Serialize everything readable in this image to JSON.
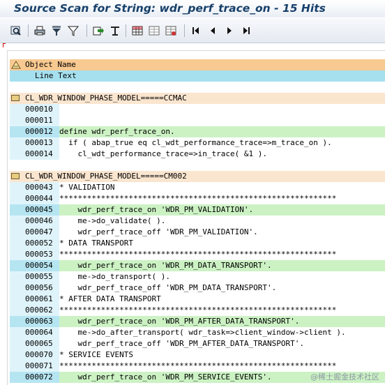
{
  "window": {
    "title": "Source Scan for String: wdr_perf_trace_on - 15 Hits"
  },
  "toolbar": {
    "icons": [
      "find-icon",
      "print-icon",
      "filter-icon",
      "funnel-icon",
      "export-icon",
      "sort-icon",
      "grid-icon",
      "layout-icon",
      "layout-change-icon",
      "first-page-icon",
      "prev-page-icon",
      "next-page-icon",
      "last-page-icon"
    ]
  },
  "list_header": {
    "col1": "Object Name",
    "col2": "Line Text"
  },
  "blocks": [
    {
      "object": "CL_WDR_WINDOW_PHASE_MODEL=====CCMAC",
      "lines": [
        {
          "num": "000010",
          "text": "",
          "hit": false
        },
        {
          "num": "000011",
          "text": "",
          "hit": false
        },
        {
          "num": "000012",
          "text": "define wdr_perf_trace_on.",
          "hit": true
        },
        {
          "num": "000013",
          "text": "  if ( abap_true eq cl_wdt_performance_trace=>m_trace_on ).",
          "hit": false
        },
        {
          "num": "000014",
          "text": "    cl_wdt_performance_trace=>in_trace( &1 ).",
          "hit": false
        }
      ]
    },
    {
      "object": "CL_WDR_WINDOW_PHASE_MODEL=====CM002",
      "lines": [
        {
          "num": "000043",
          "text": "* VALIDATION",
          "hit": false
        },
        {
          "num": "000044",
          "text": "************************************************************",
          "hit": false
        },
        {
          "num": "000045",
          "text": "    wdr_perf_trace_on 'WDR_PM_VALIDATION'.",
          "hit": true
        },
        {
          "num": "000046",
          "text": "    me->do_validate( ).",
          "hit": false
        },
        {
          "num": "000047",
          "text": "    wdr_perf_trace_off 'WDR_PM_VALIDATION'.",
          "hit": false
        },
        {
          "num": "000052",
          "text": "* DATA TRANSPORT",
          "hit": false
        },
        {
          "num": "000053",
          "text": "************************************************************",
          "hit": false
        },
        {
          "num": "000054",
          "text": "    wdr_perf_trace_on 'WDR_PM_DATA_TRANSPORT'.",
          "hit": true
        },
        {
          "num": "000055",
          "text": "    me->do_transport( ).",
          "hit": false
        },
        {
          "num": "000056",
          "text": "    wdr_perf_trace_off 'WDR_PM_DATA_TRANSPORT'.",
          "hit": false
        },
        {
          "num": "000061",
          "text": "* AFTER DATA TRANSPORT",
          "hit": false
        },
        {
          "num": "000062",
          "text": "************************************************************",
          "hit": false
        },
        {
          "num": "000063",
          "text": "    wdr_perf_trace_on 'WDR_PM_AFTER_DATA_TRANSPORT'.",
          "hit": true
        },
        {
          "num": "000064",
          "text": "    me->do_after_transport( wdr_task=>client_window->client ).",
          "hit": false
        },
        {
          "num": "000065",
          "text": "    wdr_perf_trace_off 'WDR_PM_AFTER_DATA_TRANSPORT'.",
          "hit": false
        },
        {
          "num": "000070",
          "text": "* SERVICE EVENTS",
          "hit": false
        },
        {
          "num": "000071",
          "text": "************************************************************",
          "hit": false
        },
        {
          "num": "000072",
          "text": "    wdr_perf_trace_on 'WDR_PM_SERVICE_EVENTS'.",
          "hit": true
        }
      ]
    }
  ],
  "watermark": "@稀土掘金技术社区"
}
